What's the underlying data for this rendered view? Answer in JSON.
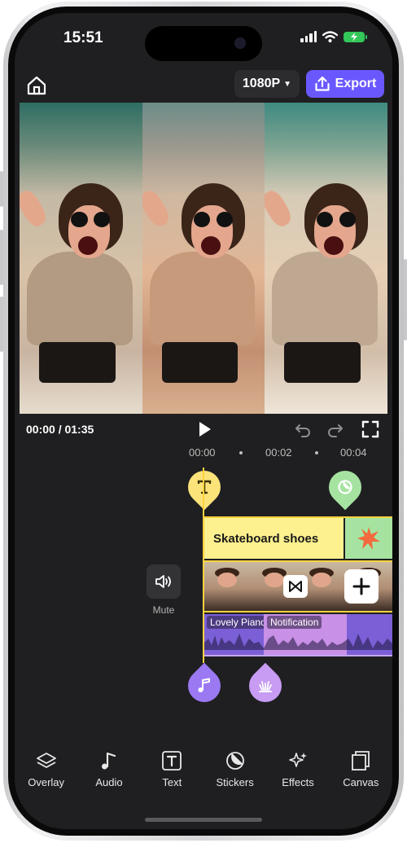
{
  "status_bar": {
    "time": "15:51"
  },
  "toolbar_top": {
    "resolution": "1080P",
    "export_label": "Export"
  },
  "playback": {
    "current": "00:00",
    "separator": " / ",
    "duration": "01:35"
  },
  "ruler": {
    "labels": [
      "00:00",
      "00:02",
      "00:04"
    ]
  },
  "timeline": {
    "text_clip_label": "Skateboard shoes",
    "mute_label": "Mute",
    "audio_clips": [
      "Lovely Piano",
      "Notification"
    ]
  },
  "bottom_tools": [
    "Overlay",
    "Audio",
    "Text",
    "Stickers",
    "Effects",
    "Canvas"
  ],
  "colors": {
    "accent": "#6a58ff",
    "playhead": "#ffd23f",
    "text_track": "#fdf08e",
    "sticker_track": "#a6e3a1",
    "audio_track": "#7b5fd6",
    "background": "#1f1f21"
  },
  "icons": [
    "home-icon",
    "export-icon",
    "play-icon",
    "undo-icon",
    "redo-icon",
    "fullscreen-icon",
    "text-icon",
    "sticker-icon",
    "speaker-icon",
    "music-note-icon",
    "effect-icon",
    "layers-icon",
    "canvas-icon"
  ]
}
